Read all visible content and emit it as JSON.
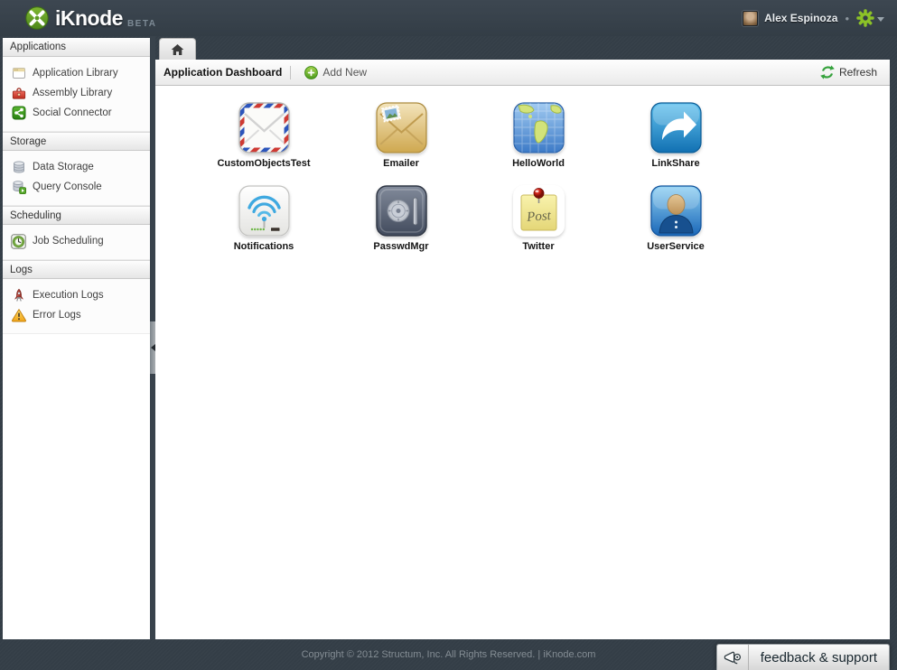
{
  "header": {
    "logo_text": "iKnode",
    "logo_badge": "BETA",
    "user_name": "Alex Espinoza",
    "user_bullet": "•"
  },
  "sidebar": {
    "sections": [
      {
        "header": "Applications",
        "items": [
          {
            "label": "Application Library",
            "icon": "window-icon"
          },
          {
            "label": "Assembly Library",
            "icon": "toolbox-icon"
          },
          {
            "label": "Social Connector",
            "icon": "share-icon"
          }
        ]
      },
      {
        "header": "Storage",
        "items": [
          {
            "label": "Data Storage",
            "icon": "database-icon"
          },
          {
            "label": "Query Console",
            "icon": "database-play-icon"
          }
        ]
      },
      {
        "header": "Scheduling",
        "items": [
          {
            "label": "Job Scheduling",
            "icon": "clock-icon"
          }
        ]
      },
      {
        "header": "Logs",
        "items": [
          {
            "label": "Execution Logs",
            "icon": "rocket-icon"
          },
          {
            "label": "Error Logs",
            "icon": "warning-icon"
          }
        ]
      }
    ]
  },
  "main": {
    "tab_icon": "home-icon",
    "toolbar": {
      "title": "Application Dashboard",
      "add_new_label": "Add New",
      "refresh_label": "Refresh"
    },
    "apps": [
      {
        "name": "CustomObjectsTest",
        "icon": "airmail-envelope-icon"
      },
      {
        "name": "Emailer",
        "icon": "envelope-stamp-icon"
      },
      {
        "name": "HelloWorld",
        "icon": "globe-map-icon"
      },
      {
        "name": "LinkShare",
        "icon": "share-arrow-icon"
      },
      {
        "name": "Notifications",
        "icon": "wifi-router-icon"
      },
      {
        "name": "PasswdMgr",
        "icon": "safe-dial-icon"
      },
      {
        "name": "Twitter",
        "icon": "sticky-note-pin-icon"
      },
      {
        "name": "UserService",
        "icon": "person-icon"
      }
    ]
  },
  "footer": {
    "copyright": "Copyright © 2012 Structum, Inc. All Rights Reserved. | iKnode.com",
    "feedback_label": "feedback & support"
  },
  "colors": {
    "accent_green": "#7cb82f",
    "chrome_dark": "#39434c",
    "panel_white": "#ffffff"
  }
}
